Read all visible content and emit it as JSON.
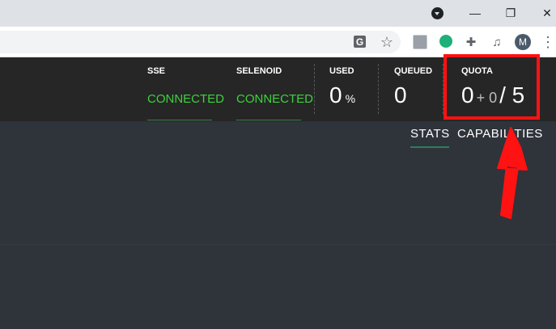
{
  "browser": {
    "title_bar": {
      "profile_icon": "profile-dropdown-icon",
      "minimize_icon": "minimize-icon",
      "restore_icon": "restore-icon",
      "close_icon": "close-icon",
      "minimize_glyph": "—",
      "restore_glyph": "❐",
      "close_glyph": "✕"
    },
    "toolbar": {
      "icons": [
        "translate-icon",
        "bookmark-star-icon",
        "extension-photo-icon",
        "extension-green-icon",
        "extensions-puzzle-icon",
        "media-playlist-icon",
        "profile-avatar",
        "more-menu-icon"
      ],
      "translate_glyph": "G",
      "star_glyph": "☆",
      "puzzle_glyph": "✚",
      "media_glyph": "♫",
      "more_glyph": "⋮",
      "avatar_letter": "M"
    }
  },
  "header": {
    "stats": [
      {
        "title": "SSE",
        "status": "CONNECTED"
      },
      {
        "title": "SELENOID",
        "status": "CONNECTED"
      },
      {
        "title": "USED",
        "value": "0",
        "unit": "%"
      },
      {
        "title": "QUEUED",
        "value": "0"
      },
      {
        "title": "QUOTA",
        "value": "0",
        "plus": "+ 0",
        "slash_total": "/ 5"
      }
    ],
    "status_color": "#3dd23d"
  },
  "tabs": [
    {
      "label": "STATS",
      "active": true
    },
    {
      "label": "CAPABILITIES",
      "active": false
    }
  ],
  "annotation": {
    "highlight_color": "#ff1212",
    "arrow_icon": "red-arrow-icon"
  }
}
